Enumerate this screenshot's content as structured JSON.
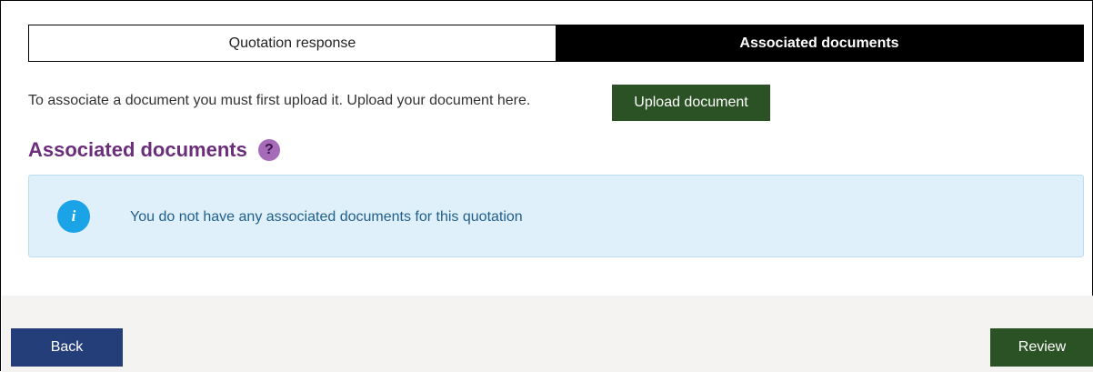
{
  "tabs": [
    {
      "label": "Quotation response",
      "active": false
    },
    {
      "label": "Associated documents",
      "active": true
    }
  ],
  "upload": {
    "instruction": "To associate a document you must first upload it. Upload your document here.",
    "button_label": "Upload document"
  },
  "section": {
    "title": "Associated documents",
    "help_icon": "?"
  },
  "info": {
    "icon": "i",
    "message": "You do not have any associated documents for this quotation"
  },
  "footer": {
    "back_label": "Back",
    "review_label": "Review"
  },
  "colors": {
    "primary_green": "#2b5224",
    "back_blue": "#243e7a",
    "heading_purple": "#6b2e7a",
    "info_bg": "#dff0fa",
    "info_icon": "#1aa3e6"
  }
}
